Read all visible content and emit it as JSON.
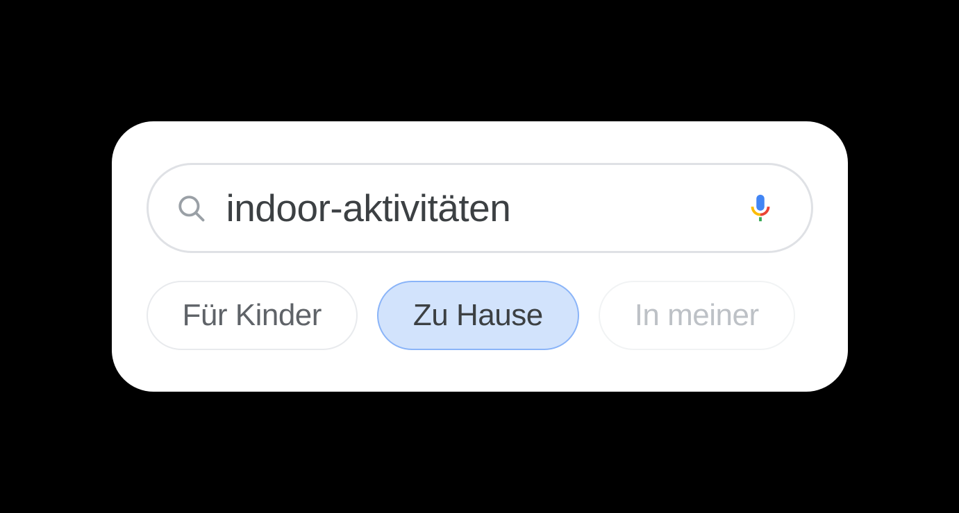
{
  "search": {
    "query": "indoor-aktivitäten"
  },
  "chips": [
    {
      "label": "Für Kinder",
      "state": "default"
    },
    {
      "label": "Zu Hause",
      "state": "selected"
    },
    {
      "label": "In meiner",
      "state": "faded"
    }
  ]
}
